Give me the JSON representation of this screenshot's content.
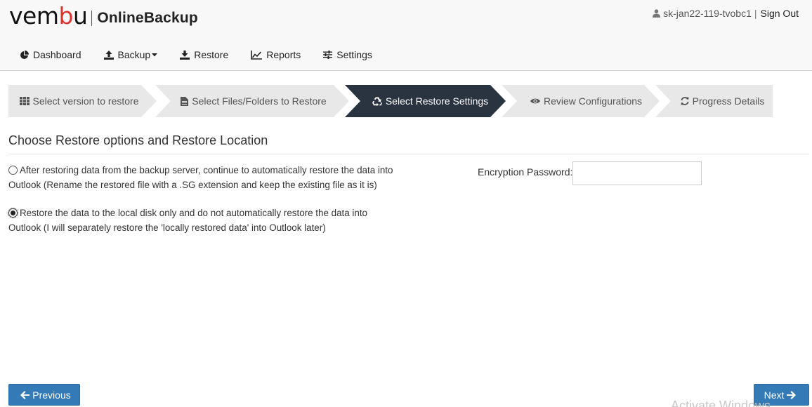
{
  "brand": {
    "logo_prefix": "vem",
    "logo_accent": "b",
    "logo_suffix": "u",
    "product": "OnlineBackup"
  },
  "user": {
    "name": "sk-jan22-119-tvobc1",
    "separator": "|",
    "sign_out": "Sign Out"
  },
  "nav": {
    "dashboard": "Dashboard",
    "backup": "Backup",
    "restore": "Restore",
    "reports": "Reports",
    "settings": "Settings"
  },
  "steps": [
    {
      "label": "Select version to restore",
      "icon": "grid-icon",
      "state": "done"
    },
    {
      "label": "Select Files/Folders to Restore",
      "icon": "file-icon",
      "state": "done"
    },
    {
      "label": "Select Restore Settings",
      "icon": "recycle-icon",
      "state": "active"
    },
    {
      "label": "Review Configurations",
      "icon": "eye-icon",
      "state": "pending"
    },
    {
      "label": "Progress Details",
      "icon": "refresh-icon",
      "state": "pending"
    }
  ],
  "main": {
    "title": "Choose Restore options and Restore Location",
    "options": [
      {
        "label": "After restoring data from the backup server, continue to automatically restore the data into Outlook (Rename the restored file with a .SG extension and keep the existing file as it is)",
        "checked": false
      },
      {
        "label": "Restore the data to the local disk only and do not automatically restore the data into Outlook (I will separately restore the 'locally restored data' into Outlook later)",
        "checked": true
      }
    ],
    "encryption_label": "Encryption Password:",
    "encryption_value": ""
  },
  "footer": {
    "previous": "Previous",
    "next": "Next"
  },
  "watermark": "Activate Windows",
  "colors": {
    "active_step": "#2a3440",
    "step_bg": "#e8e8e8",
    "primary_button": "#337ab7",
    "logo_accent": "#e0332f"
  }
}
